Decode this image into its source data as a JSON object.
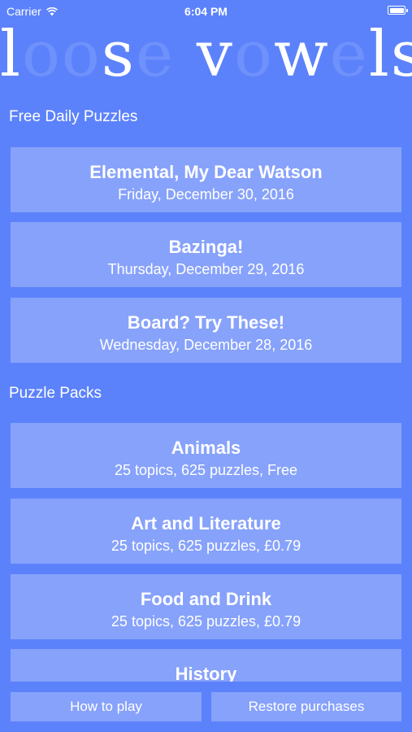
{
  "status_bar": {
    "carrier": "Carrier",
    "time": "6:04 PM"
  },
  "logo": {
    "letters": [
      "l",
      "o",
      "o",
      "s",
      "e",
      " ",
      "v",
      "o",
      "w",
      "e",
      "l",
      "s"
    ],
    "faint": [
      false,
      true,
      true,
      false,
      true,
      false,
      false,
      true,
      false,
      true,
      false,
      false
    ]
  },
  "daily": {
    "heading": "Free Daily Puzzles",
    "items": [
      {
        "title": "Elemental, My Dear Watson",
        "subtitle": "Friday, December 30, 2016"
      },
      {
        "title": "Bazinga!",
        "subtitle": "Thursday, December 29, 2016"
      },
      {
        "title": "Board? Try These!",
        "subtitle": "Wednesday, December 28, 2016"
      }
    ]
  },
  "packs": {
    "heading": "Puzzle Packs",
    "items": [
      {
        "title": "Animals",
        "subtitle": "25 topics, 625 puzzles, Free"
      },
      {
        "title": "Art and Literature",
        "subtitle": "25 topics, 625 puzzles, £0.79"
      },
      {
        "title": "Food and Drink",
        "subtitle": "25 topics, 625 puzzles, £0.79"
      },
      {
        "title": "History"
      }
    ]
  },
  "footer": {
    "how_to_play": "How to play",
    "restore": "Restore purchases"
  },
  "colors": {
    "background": "#5c82fb",
    "card": "#87a2fb",
    "text": "#ffffff"
  }
}
